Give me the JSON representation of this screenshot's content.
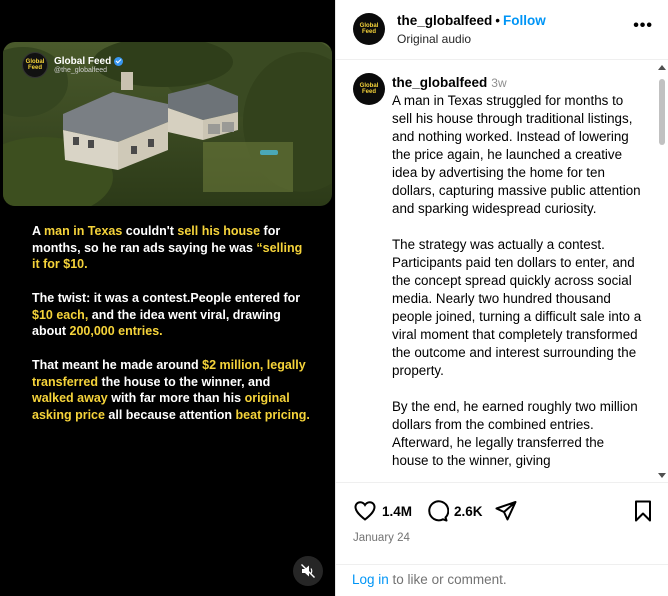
{
  "media": {
    "brand_name": "Global Feed",
    "brand_handle": "@the_globalfeed",
    "logo_text": "Global Feed",
    "caption": {
      "p1": [
        {
          "t": "A ",
          "h": false
        },
        {
          "t": "man in Texas",
          "h": true
        },
        {
          "t": " couldn't ",
          "h": false
        },
        {
          "t": "sell his house",
          "h": true
        },
        {
          "t": " for months, so he ran ads saying he was ",
          "h": false
        },
        {
          "t": "“selling it for $10.",
          "h": true
        }
      ],
      "p2": [
        {
          "t": "The twist: it was a contest.People entered for ",
          "h": false
        },
        {
          "t": "$10 each,",
          "h": true
        },
        {
          "t": " and the idea went viral, drawing about ",
          "h": false
        },
        {
          "t": "200,000 entries.",
          "h": true
        }
      ],
      "p3": [
        {
          "t": "That meant he made around ",
          "h": false
        },
        {
          "t": "$2 million,",
          "h": true
        },
        {
          "t": " ",
          "h": false
        },
        {
          "t": "legally transferred",
          "h": true
        },
        {
          "t": " the house to the winner, and ",
          "h": false
        },
        {
          "t": "walked away",
          "h": true
        },
        {
          "t": " with far more than his ",
          "h": false
        },
        {
          "t": "original asking price",
          "h": true
        },
        {
          "t": " all because attention ",
          "h": false
        },
        {
          "t": "beat pricing.",
          "h": true
        }
      ]
    },
    "mute_icon": "speaker-muted-icon"
  },
  "header": {
    "username": "the_globalfeed",
    "dot": "•",
    "follow_label": "Follow",
    "audio": "Original audio",
    "more": "•••"
  },
  "post": {
    "username": "the_globalfeed",
    "time": "3w",
    "paragraphs": [
      "A man in Texas struggled for months to sell his house through traditional listings, and nothing worked. Instead of lowering the price again, he launched a creative idea by advertising the home for ten dollars, capturing massive public attention and sparking widespread curiosity.",
      "The strategy was actually a contest. Participants paid ten dollars to enter, and the concept spread quickly across social media. Nearly two hundred thousand people joined, turning a difficult sale into a viral moment that completely transformed the outcome and interest surrounding the property.",
      "By the end, he earned roughly two million dollars from the combined entries. Afterward, he legally transferred the house to the winner, giving"
    ]
  },
  "actions": {
    "likes": "1.4M",
    "comments": "2.6K",
    "date": "January 24"
  },
  "login": {
    "link": "Log in",
    "rest": " to like or comment."
  },
  "colors": {
    "accent_blue": "#0095f6",
    "highlight_yellow": "#f5d33a",
    "media_bg": "#000000"
  }
}
